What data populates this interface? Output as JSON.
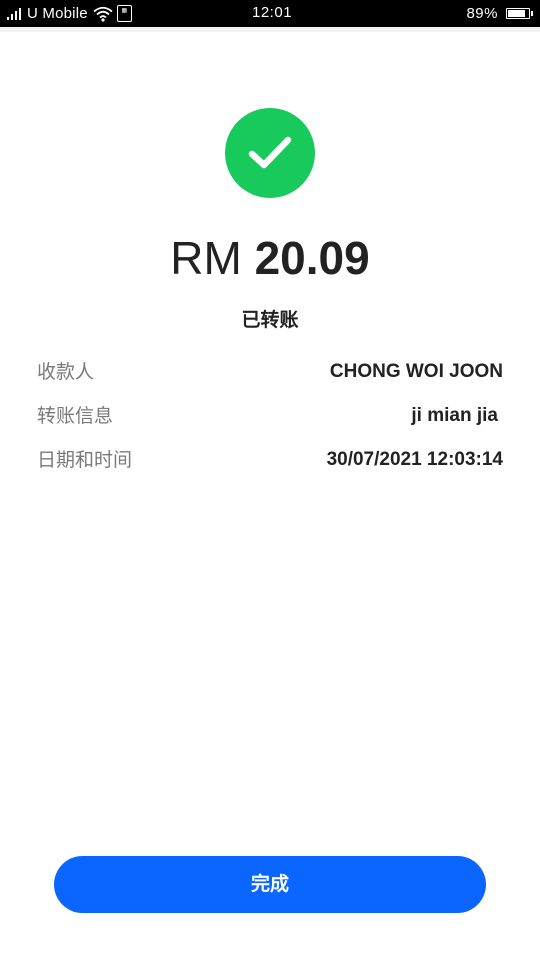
{
  "status_bar": {
    "carrier": "U Mobile",
    "time": "12:01",
    "battery_percent": "89%",
    "battery_level": 0.89,
    "icons": [
      "signal-icon",
      "wifi-icon",
      "sim-icon",
      "battery-icon"
    ]
  },
  "receipt": {
    "currency": "RM",
    "amount": "20.09",
    "status": "已转账",
    "success_icon": "check-circle-icon",
    "accent_color": "#18c95c"
  },
  "details": [
    {
      "label": "收款人",
      "value": "CHONG WOI JOON"
    },
    {
      "label": "转账信息",
      "value": "ji mian jia"
    },
    {
      "label": "日期和时间",
      "value": "30/07/2021 12:03:14"
    }
  ],
  "actions": {
    "done_label": "完成",
    "button_color": "#0a66ff"
  }
}
